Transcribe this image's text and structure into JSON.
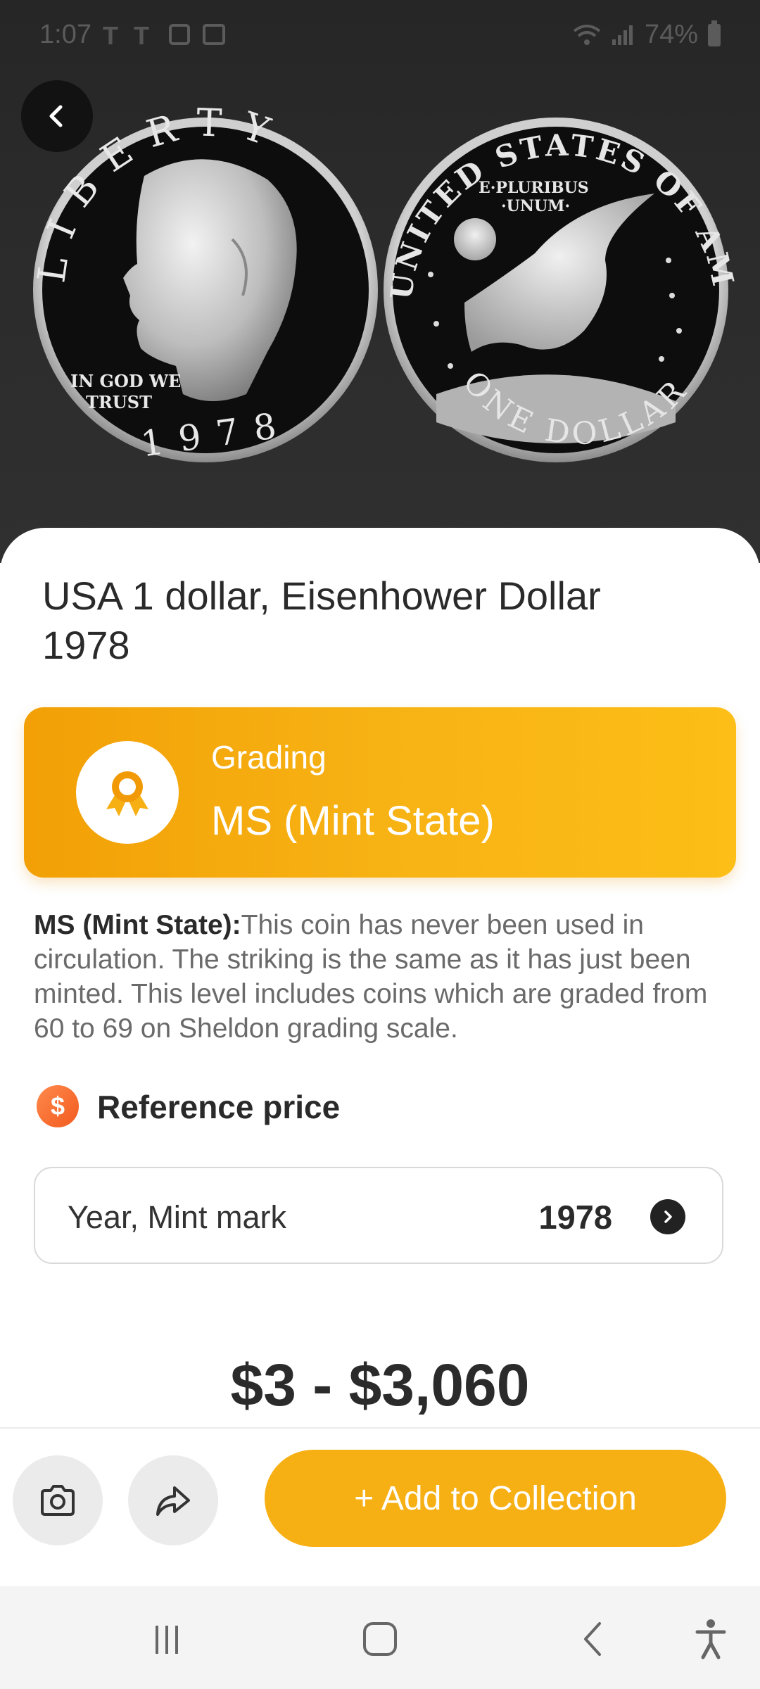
{
  "status_bar": {
    "time": "1:07",
    "carrier_1": "T",
    "carrier_2": "T",
    "battery": "74%"
  },
  "coin_image": {
    "obverse_top_text": "LIBERTY",
    "obverse_motto_1": "IN GOD WE",
    "obverse_motto_2": "TRUST",
    "obverse_year": "1978",
    "reverse_top_text": "UNITED STATES OF AMERICA",
    "reverse_motto_1": "E·PLURIBUS",
    "reverse_motto_2": "·UNUM·",
    "reverse_bottom_text": "ONE DOLLAR"
  },
  "coin": {
    "title": "USA 1 dollar, Eisenhower Dollar 1978"
  },
  "grading": {
    "label": "Grading",
    "value": "MS (Mint State)"
  },
  "grade_description": {
    "term": "MS (Mint State):",
    "text": "This coin has never been used in circulation. The striking is the same as it has just been minted. This level includes coins which are graded from 60 to 69 on Sheldon grading scale."
  },
  "reference_price": {
    "icon_text": "$",
    "label": "Reference price",
    "year_field_label": "Year, Mint mark",
    "year_value": "1978",
    "price_range": "$3 - $3,060"
  },
  "actions": {
    "add_label": "+ Add to Collection"
  },
  "colors": {
    "accent": "#F7B014",
    "card_gradient_start": "#F2A006",
    "card_gradient_end": "#FDBE17",
    "price_icon": "#F25A1E"
  },
  "icons": {
    "back": "back-arrow-icon",
    "grading": "award-ribbon-icon",
    "price": "dollar-icon",
    "year_chevron": "chevron-right-icon",
    "camera": "camera-icon",
    "share": "share-icon",
    "nav_recents": "recents-icon",
    "nav_home": "home-icon",
    "nav_back": "nav-back-icon",
    "nav_accessibility": "accessibility-icon"
  }
}
